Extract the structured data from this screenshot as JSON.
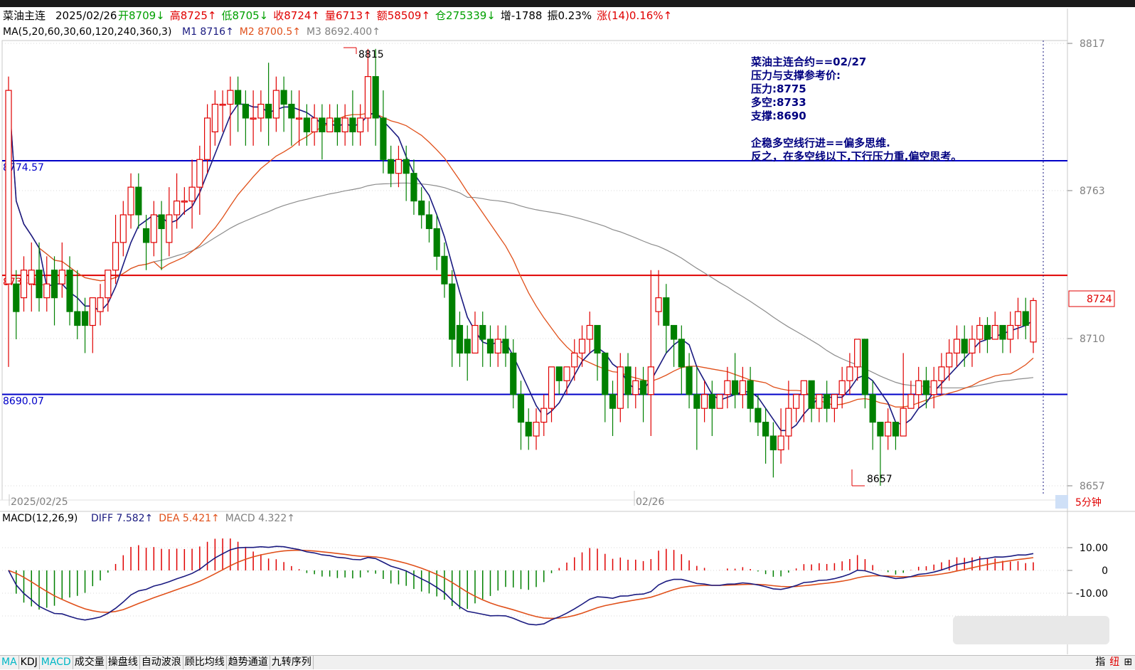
{
  "header": {
    "name": "菜油主连",
    "date": "2025/02/26",
    "items": [
      {
        "text": "开8709↓",
        "color": "#00a000"
      },
      {
        "text": "高8725↑",
        "color": "#e00000"
      },
      {
        "text": "低8705↓",
        "color": "#00a000"
      },
      {
        "text": "收8724↑",
        "color": "#e00000"
      },
      {
        "text": "量6713↑",
        "color": "#e00000"
      },
      {
        "text": "额58509↑",
        "color": "#e00000"
      },
      {
        "text": "仓275339↓",
        "color": "#00a000"
      },
      {
        "text": "增-1788",
        "color": "#000000"
      },
      {
        "text": "振0.23%",
        "color": "#000000"
      },
      {
        "text": "涨(14)0.16%↑",
        "color": "#e00000"
      }
    ]
  },
  "ma_legend": {
    "title": "MA(5,20,60,30,60,120,240,360,3)",
    "items": [
      {
        "text": "M1 8716↑",
        "color": "#1a1a80"
      },
      {
        "text": "M2 8700.5↑",
        "color": "#e0501a"
      },
      {
        "text": "M3 8692.400↑",
        "color": "#808080"
      }
    ]
  },
  "annotation": {
    "lines": [
      "菜油主连合约==02/27",
      "压力与支撑参考价:",
      "压力:8775",
      "多空:8733",
      "支撑:8690",
      "",
      "企稳多空线行进==偏多思维.",
      "反之，在多空线以下,下行压力重,偏空思考。"
    ]
  },
  "levels": [
    {
      "value": 8774.57,
      "label": "8774.57",
      "color": "#0000c8"
    },
    {
      "value": 8733.11,
      "label": "8733.11",
      "color": "#e00000"
    },
    {
      "value": 8690.07,
      "label": "8690.07",
      "color": "#0000c8"
    }
  ],
  "price_axis": {
    "ticks": [
      "8817",
      "8763",
      "8710",
      "8657"
    ],
    "current": "8724"
  },
  "date_labels": [
    {
      "text": "2025/02/25"
    },
    {
      "text": "02/26"
    }
  ],
  "period": "5分钟",
  "macd_legend": {
    "title": "MACD(12,26,9)",
    "items": [
      {
        "text": "DIFF 7.582↑",
        "color": "#1a1a80"
      },
      {
        "text": "DEA 5.421↑",
        "color": "#e0501a"
      },
      {
        "text": "MACD 4.322↑",
        "color": "#808080"
      }
    ]
  },
  "macd_axis": {
    "ticks": [
      "10.00",
      "0",
      "-10.00"
    ]
  },
  "tabs": [
    "MA",
    "KDJ",
    "MACD",
    "成交量",
    "操盘线",
    "自动波浪",
    "顾比均线",
    "趋势通道",
    "九转序列"
  ],
  "right_tabs": [
    "指",
    "纽",
    "⊞"
  ],
  "chart_data": {
    "type": "candlestick",
    "ylim": [
      8657,
      8817
    ],
    "high_label": "8815",
    "low_label": "8657",
    "candles": [
      [
        8730,
        8800,
        8700,
        8805
      ],
      [
        8730,
        8720,
        8710,
        8735
      ],
      [
        8725,
        8735,
        8720,
        8740
      ],
      [
        8730,
        8735,
        8720,
        8745
      ],
      [
        8735,
        8725,
        8720,
        8745
      ],
      [
        8725,
        8730,
        8720,
        8740
      ],
      [
        8735,
        8725,
        8715,
        8740
      ],
      [
        8730,
        8735,
        8725,
        8745
      ],
      [
        8735,
        8720,
        8715,
        8740
      ],
      [
        8720,
        8715,
        8710,
        8735
      ],
      [
        8720,
        8715,
        8705,
        8725
      ],
      [
        8715,
        8725,
        8705,
        8725
      ],
      [
        8720,
        8725,
        8715,
        8730
      ],
      [
        8725,
        8735,
        8720,
        8735
      ],
      [
        8735,
        8745,
        8730,
        8755
      ],
      [
        8745,
        8755,
        8740,
        8760
      ],
      [
        8755,
        8765,
        8750,
        8770
      ],
      [
        8765,
        8755,
        8750,
        8770
      ],
      [
        8750,
        8745,
        8735,
        8755
      ],
      [
        8745,
        8755,
        8740,
        8760
      ],
      [
        8755,
        8750,
        8735,
        8760
      ],
      [
        8745,
        8755,
        8740,
        8765
      ],
      [
        8755,
        8760,
        8750,
        8770
      ],
      [
        8760,
        8760,
        8755,
        8765
      ],
      [
        8760,
        8765,
        8750,
        8775
      ],
      [
        8765,
        8775,
        8755,
        8780
      ],
      [
        8775,
        8790,
        8770,
        8795
      ],
      [
        8785,
        8795,
        8780,
        8800
      ],
      [
        8795,
        8795,
        8785,
        8800
      ],
      [
        8795,
        8800,
        8780,
        8805
      ],
      [
        8800,
        8795,
        8785,
        8805
      ],
      [
        8795,
        8790,
        8780,
        8800
      ],
      [
        8790,
        8790,
        8780,
        8800
      ],
      [
        8790,
        8795,
        8785,
        8800
      ],
      [
        8795,
        8790,
        8780,
        8810
      ],
      [
        8790,
        8800,
        8785,
        8805
      ],
      [
        8800,
        8795,
        8785,
        8805
      ],
      [
        8795,
        8790,
        8780,
        8800
      ],
      [
        8790,
        8790,
        8780,
        8800
      ],
      [
        8790,
        8785,
        8780,
        8795
      ],
      [
        8785,
        8790,
        8780,
        8795
      ],
      [
        8790,
        8785,
        8775,
        8795
      ],
      [
        8785,
        8790,
        8785,
        8795
      ],
      [
        8790,
        8785,
        8780,
        8795
      ],
      [
        8785,
        8790,
        8780,
        8795
      ],
      [
        8790,
        8785,
        8780,
        8800
      ],
      [
        8785,
        8790,
        8780,
        8795
      ],
      [
        8790,
        8805,
        8785,
        8815
      ],
      [
        8805,
        8790,
        8780,
        8815
      ],
      [
        8790,
        8775,
        8770,
        8800
      ],
      [
        8775,
        8770,
        8765,
        8780
      ],
      [
        8770,
        8775,
        8765,
        8780
      ],
      [
        8775,
        8770,
        8760,
        8780
      ],
      [
        8770,
        8760,
        8755,
        8775
      ],
      [
        8760,
        8755,
        8750,
        8765
      ],
      [
        8755,
        8750,
        8745,
        8760
      ],
      [
        8750,
        8740,
        8735,
        8755
      ],
      [
        8740,
        8730,
        8725,
        8745
      ],
      [
        8730,
        8710,
        8700,
        8735
      ],
      [
        8715,
        8705,
        8700,
        8720
      ],
      [
        8710,
        8705,
        8695,
        8715
      ],
      [
        8705,
        8715,
        8705,
        8720
      ],
      [
        8715,
        8710,
        8700,
        8720
      ],
      [
        8710,
        8705,
        8700,
        8715
      ],
      [
        8705,
        8710,
        8700,
        8715
      ],
      [
        8710,
        8705,
        8700,
        8715
      ],
      [
        8705,
        8690,
        8685,
        8710
      ],
      [
        8690,
        8680,
        8670,
        8695
      ],
      [
        8680,
        8675,
        8670,
        8685
      ],
      [
        8675,
        8680,
        8670,
        8685
      ],
      [
        8680,
        8685,
        8675,
        8690
      ],
      [
        8685,
        8700,
        8680,
        8700
      ],
      [
        8700,
        8695,
        8690,
        8700
      ],
      [
        8695,
        8700,
        8690,
        8700
      ],
      [
        8700,
        8705,
        8695,
        8710
      ],
      [
        8705,
        8710,
        8700,
        8715
      ],
      [
        8710,
        8715,
        8705,
        8720
      ],
      [
        8715,
        8705,
        8695,
        8715
      ],
      [
        8705,
        8690,
        8680,
        8705
      ],
      [
        8690,
        8685,
        8675,
        8695
      ],
      [
        8685,
        8700,
        8680,
        8705
      ],
      [
        8700,
        8690,
        8685,
        8705
      ],
      [
        8690,
        8695,
        8685,
        8700
      ],
      [
        8695,
        8690,
        8680,
        8700
      ],
      [
        8690,
        8700,
        8675,
        8735
      ],
      [
        8720,
        8725,
        8715,
        8735
      ],
      [
        8725,
        8715,
        8705,
        8730
      ],
      [
        8715,
        8710,
        8700,
        8715
      ],
      [
        8710,
        8700,
        8690,
        8715
      ],
      [
        8700,
        8690,
        8685,
        8705
      ],
      [
        8690,
        8685,
        8670,
        8700
      ],
      [
        8685,
        8690,
        8680,
        8695
      ],
      [
        8690,
        8685,
        8675,
        8695
      ],
      [
        8685,
        8690,
        8685,
        8690
      ],
      [
        8690,
        8695,
        8685,
        8700
      ],
      [
        8695,
        8690,
        8685,
        8705
      ],
      [
        8690,
        8695,
        8685,
        8700
      ],
      [
        8695,
        8685,
        8680,
        8700
      ],
      [
        8685,
        8680,
        8675,
        8690
      ],
      [
        8680,
        8675,
        8665,
        8685
      ],
      [
        8675,
        8670,
        8660,
        8680
      ],
      [
        8670,
        8675,
        8665,
        8685
      ],
      [
        8675,
        8685,
        8670,
        8695
      ],
      [
        8685,
        8690,
        8680,
        8690
      ],
      [
        8690,
        8695,
        8680,
        8695
      ],
      [
        8695,
        8685,
        8680,
        8695
      ],
      [
        8685,
        8690,
        8680,
        8690
      ],
      [
        8690,
        8685,
        8680,
        8695
      ],
      [
        8685,
        8690,
        8680,
        8690
      ],
      [
        8690,
        8695,
        8685,
        8700
      ],
      [
        8695,
        8700,
        8690,
        8705
      ],
      [
        8700,
        8710,
        8695,
        8710
      ],
      [
        8710,
        8690,
        8685,
        8710
      ],
      [
        8690,
        8680,
        8670,
        8695
      ],
      [
        8680,
        8675,
        8657,
        8680
      ],
      [
        8675,
        8680,
        8670,
        8685
      ],
      [
        8680,
        8675,
        8670,
        8680
      ],
      [
        8675,
        8685,
        8675,
        8705
      ],
      [
        8685,
        8690,
        8685,
        8695
      ],
      [
        8690,
        8695,
        8685,
        8700
      ],
      [
        8695,
        8690,
        8685,
        8700
      ],
      [
        8690,
        8695,
        8685,
        8700
      ],
      [
        8695,
        8700,
        8690,
        8705
      ],
      [
        8700,
        8705,
        8695,
        8710
      ],
      [
        8705,
        8710,
        8700,
        8715
      ],
      [
        8710,
        8705,
        8700,
        8715
      ],
      [
        8705,
        8710,
        8700,
        8715
      ],
      [
        8710,
        8715,
        8705,
        8718
      ],
      [
        8715,
        8710,
        8705,
        8718
      ],
      [
        8710,
        8715,
        8710,
        8720
      ],
      [
        8715,
        8710,
        8705,
        8715
      ],
      [
        8710,
        8715,
        8705,
        8720
      ],
      [
        8715,
        8720,
        8710,
        8725
      ],
      [
        8720,
        8715,
        8710,
        8725
      ],
      [
        8709,
        8724,
        8705,
        8725
      ]
    ]
  }
}
